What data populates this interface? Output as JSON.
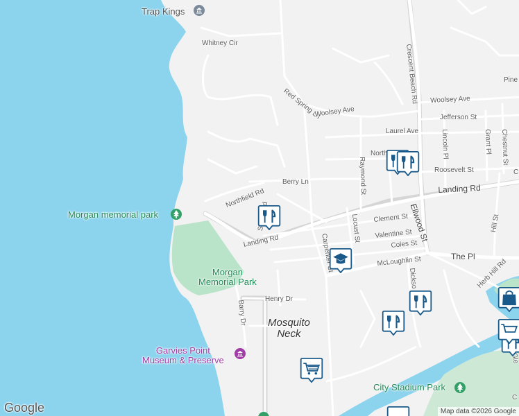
{
  "colors": {
    "water": "#8cd4ee",
    "land": "#f2f2f2",
    "park": "#b9e4c9",
    "road": "#ffffff",
    "road_outline": "#d6d6d6",
    "pin_fill": "#1a5a8a",
    "museum": "#a13da6",
    "park_label": "#1f8a55"
  },
  "streets": {
    "whitney_cir": "Whitney Cir",
    "red_spring_ln": "Red Spring Ln",
    "woolsey_ave_w": "Woolsey Ave",
    "woolsey_ave_e": "Woolsey Ave",
    "crescent_beach_rd": "Crescent Beach Rd",
    "jefferson_st": "Jefferson St",
    "laurel_ave": "Laurel Ave",
    "north_st": "North St",
    "raymond_st": "Raymond St",
    "roosevelt_st": "Roosevelt St",
    "berry_ln": "Berry Ln",
    "northfield_rd": "Northfield Rd",
    "landing_rd_e": "Landing Rd",
    "landing_rd_w": "Landing Rd",
    "shore_rd": "Shore Rd",
    "clement_st": "Clement St",
    "valentine_st": "Valentine St",
    "coles_st": "Coles St",
    "mcloughlin_st": "McLoughlin St",
    "locust_st": "Locust St",
    "carpenter_st": "Carpenter St",
    "ellwood_st": "Ellwood St",
    "the_pl": "The Pl",
    "lincoln_pl": "Lincoln Pl",
    "grant_pl": "Grant Pl",
    "chestnut_st": "Chestnut St",
    "pine": "Pine",
    "hill_st": "Hill St",
    "herb_hill_rd": "Herb Hill Rd",
    "henry_dr": "Henry Dr",
    "barry_dr": "Barry Dr",
    "dickson": "Dickso",
    "glen": "Gle",
    "c_edge": "C",
    "c_edge2": "C"
  },
  "places": {
    "trap_kings": "Trap Kings",
    "morgan_memorial_park_pin": "Morgan memorial park",
    "morgan_memorial_park": "Morgan\nMemorial Park",
    "garvies_point": "Garvies Point\nMuseum & Preserve",
    "mosquito_neck": "Mosquito\nNeck",
    "city_stadium_park": "City Stadium Park"
  },
  "markers": [
    {
      "type": "restaurant",
      "name": "restaurant-pin"
    },
    {
      "type": "restaurant",
      "name": "restaurant-pin"
    },
    {
      "type": "restaurant",
      "name": "restaurant-pin"
    },
    {
      "type": "restaurant",
      "name": "restaurant-pin"
    },
    {
      "type": "restaurant",
      "name": "restaurant-pin"
    },
    {
      "type": "school",
      "name": "school-pin"
    },
    {
      "type": "grocery",
      "name": "grocery-pin"
    },
    {
      "type": "shopping",
      "name": "shopping-pin"
    }
  ],
  "branding": {
    "logo": "Google",
    "attribution": "Map data ©2026 Google"
  }
}
